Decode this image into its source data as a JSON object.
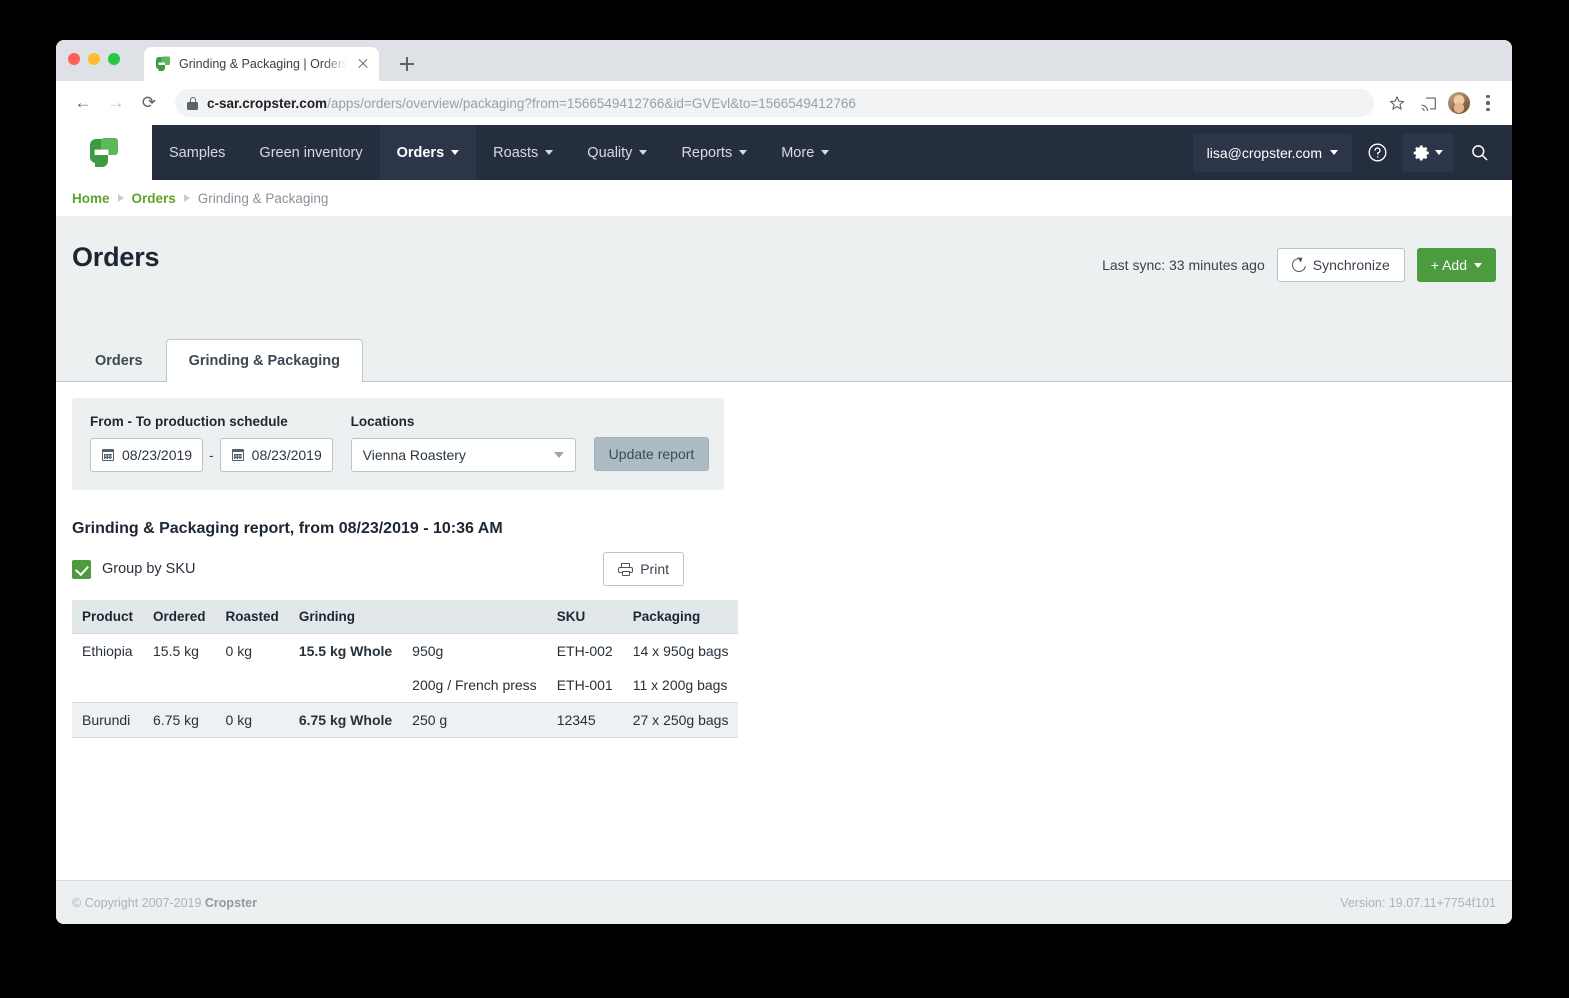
{
  "browser": {
    "tab_title": "Grinding & Packaging | Orders",
    "url_host": "c-sar.cropster.com",
    "url_path": "/apps/orders/overview/packaging?from=1566549412766&id=GVEvl&to=1566549412766",
    "back_glyph": "←",
    "forward_glyph": "→",
    "reload_glyph": "⟳",
    "star_glyph": "☆",
    "cast_glyph": "◰"
  },
  "topnav": {
    "items": [
      {
        "label": "Samples",
        "has_caret": false,
        "active": false
      },
      {
        "label": "Green inventory",
        "has_caret": false,
        "active": false
      },
      {
        "label": "Orders",
        "has_caret": true,
        "active": true
      },
      {
        "label": "Roasts",
        "has_caret": true,
        "active": false
      },
      {
        "label": "Quality",
        "has_caret": true,
        "active": false
      },
      {
        "label": "Reports",
        "has_caret": true,
        "active": false
      },
      {
        "label": "More",
        "has_caret": true,
        "active": false
      }
    ],
    "user": "lisa@cropster.com",
    "help_glyph": "?",
    "search_glyph": "⌕"
  },
  "breadcrumb": {
    "home": "Home",
    "orders": "Orders",
    "current": "Grinding & Packaging"
  },
  "page": {
    "title": "Orders",
    "last_sync": "Last sync: 33 minutes ago",
    "synchronize_label": "Synchronize",
    "add_label": "+ Add"
  },
  "tabs": [
    {
      "label": "Orders",
      "active": false
    },
    {
      "label": "Grinding & Packaging",
      "active": true
    }
  ],
  "filters": {
    "date_label": "From - To production schedule",
    "date_from": "08/23/2019",
    "date_to": "08/23/2019",
    "date_separator": "-",
    "locations_label": "Locations",
    "location_value": "Vienna Roastery",
    "update_label": "Update report"
  },
  "report": {
    "title": "Grinding & Packaging report, from 08/23/2019 - 10:36 AM",
    "group_by_sku_label": "Group by SKU",
    "group_by_sku_checked": true,
    "print_label": "Print",
    "columns": [
      "Product",
      "Ordered",
      "Roasted",
      "Grinding",
      "",
      "SKU",
      "Packaging"
    ],
    "rows": [
      {
        "product": "Ethiopia",
        "ordered": "15.5 kg",
        "roasted": "0 kg",
        "grinding_total": "15.5 kg Whole",
        "grinding_detail": "950g",
        "sku": "ETH-002",
        "packaging": "14 x 950g bags",
        "group_start": true,
        "shade": "even"
      },
      {
        "product": "",
        "ordered": "",
        "roasted": "",
        "grinding_total": "",
        "grinding_detail": "200g / French press",
        "sku": "ETH-001",
        "packaging": "11 x 200g bags",
        "group_start": false,
        "shade": "even"
      },
      {
        "product": "Burundi",
        "ordered": "6.75 kg",
        "roasted": "0 kg",
        "grinding_total": "6.75 kg Whole",
        "grinding_detail": "250 g",
        "sku": "12345",
        "packaging": "27 x 250g bags",
        "group_start": true,
        "shade": "odd"
      }
    ]
  },
  "footer": {
    "copyright_prefix": "© Copyright 2007-2019 ",
    "copyright_brand": "Cropster",
    "version": "Version: 19.07.11+7754f101"
  },
  "colors": {
    "brand_green": "#4c9b3f",
    "nav_dark": "#252e3e",
    "link_green": "#5ea32a",
    "page_bg": "#ecf0f1"
  }
}
